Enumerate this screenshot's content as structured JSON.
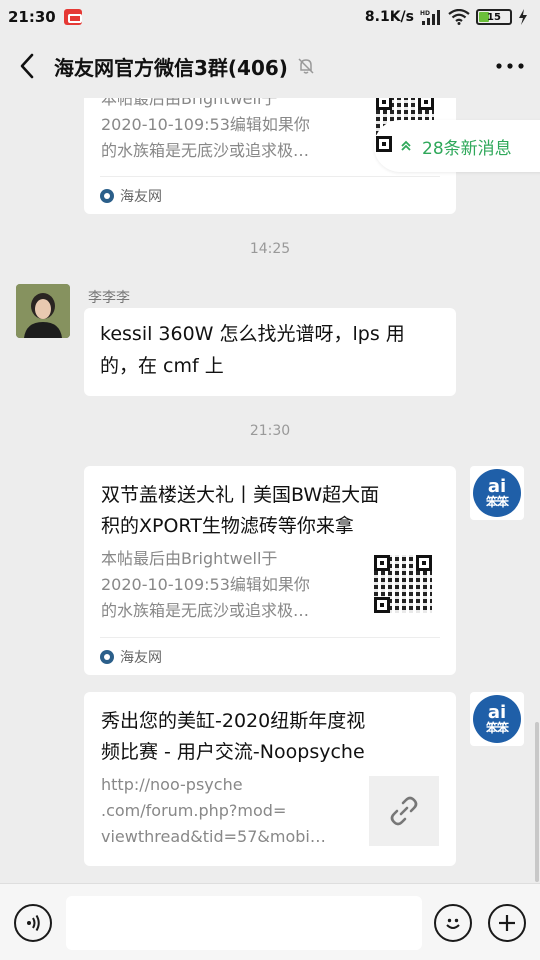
{
  "status_bar": {
    "time": "21:30",
    "speed": "8.1K/s",
    "battery": "15"
  },
  "header": {
    "title": "海友网官方微信3群(406)",
    "back_icon": "back-chevron-icon",
    "mute_icon": "mute-bell-icon",
    "more_icon": "more-dots-icon"
  },
  "new_messages": {
    "label": "28条新消息",
    "icon": "double-chevron-up-icon",
    "color": "#2fa85a"
  },
  "messages": {
    "card1": {
      "desc_lines": [
        "本帖最后由Brightwell于",
        "2020-10-109:53编辑如果你",
        "的水族箱是无底沙或追求极…"
      ],
      "source": "海友网"
    },
    "time1": "14:25",
    "text_msg": {
      "sender": "李李李",
      "text_line1": "kessil 360W 怎么找光谱呀，lps 用",
      "text_line2": "的，在 cmf 上"
    },
    "time2": "21:30",
    "card2": {
      "title_line1": "双节盖楼送大礼丨美国BW超大面",
      "title_line2": "积的XPORT生物滤砖等你来拿",
      "desc_lines": [
        "本帖最后由Brightwell于",
        "2020-10-109:53编辑如果你",
        "的水族箱是无底沙或追求极…"
      ],
      "source": "海友网"
    },
    "card3": {
      "title_line1": "秀出您的美缸-2020纽斯年度视",
      "title_line2": "频比赛 - 用户交流-Noopsyche",
      "desc_lines": [
        "http://noo-psyche",
        ".com/forum.php?mod=",
        "viewthread&tid=57&mobi…"
      ],
      "thumb_icon": "link-icon"
    },
    "bot_avatar": {
      "top": "ai",
      "bottom": "笨笨"
    }
  },
  "input_bar": {
    "voice_icon": "voice-icon",
    "emoji_icon": "emoji-icon",
    "plus_icon": "plus-icon",
    "value": ""
  }
}
